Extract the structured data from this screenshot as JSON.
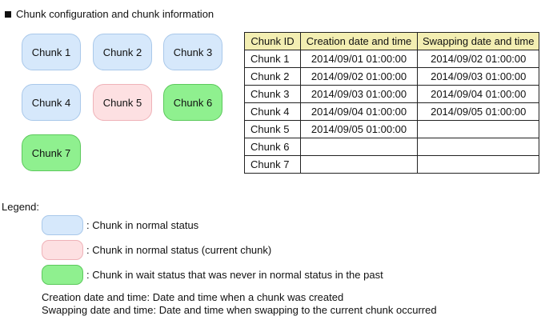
{
  "title": "Chunk configuration and chunk information",
  "chunks": [
    {
      "label": "Chunk 1",
      "status": "normal"
    },
    {
      "label": "Chunk 2",
      "status": "normal"
    },
    {
      "label": "Chunk 3",
      "status": "normal"
    },
    {
      "label": "Chunk 4",
      "status": "normal"
    },
    {
      "label": "Chunk 5",
      "status": "current"
    },
    {
      "label": "Chunk 6",
      "status": "wait"
    },
    {
      "label": "Chunk 7",
      "status": "wait"
    }
  ],
  "table": {
    "headers": [
      "Chunk ID",
      "Creation date and time",
      "Swapping date and time"
    ],
    "rows": [
      [
        "Chunk 1",
        "2014/09/01 01:00:00",
        "2014/09/02 01:00:00"
      ],
      [
        "Chunk 2",
        "2014/09/02 01:00:00",
        "2014/09/03 01:00:00"
      ],
      [
        "Chunk 3",
        "2014/09/03 01:00:00",
        "2014/09/04 01:00:00"
      ],
      [
        "Chunk 4",
        "2014/09/04 01:00:00",
        "2014/09/05 01:00:00"
      ],
      [
        "Chunk 5",
        "2014/09/05 01:00:00",
        ""
      ],
      [
        "Chunk 6",
        "",
        ""
      ],
      [
        "Chunk 7",
        "",
        ""
      ]
    ]
  },
  "legend": {
    "heading": "Legend:",
    "items": [
      {
        "status": "normal",
        "text": ": Chunk in normal status"
      },
      {
        "status": "current",
        "text": ": Chunk in normal status (current chunk)"
      },
      {
        "status": "wait",
        "text": ": Chunk in wait status that was never in normal status in the past"
      }
    ],
    "notes": [
      "Creation date and time: Date and time when a chunk was created",
      "Swapping date and time: Date and time when swapping to the current chunk occurred"
    ]
  },
  "colors": {
    "normal": "#d6e8fb",
    "current": "#fde0e2",
    "wait": "#8ff08f",
    "table_header": "#f3eeb2"
  }
}
